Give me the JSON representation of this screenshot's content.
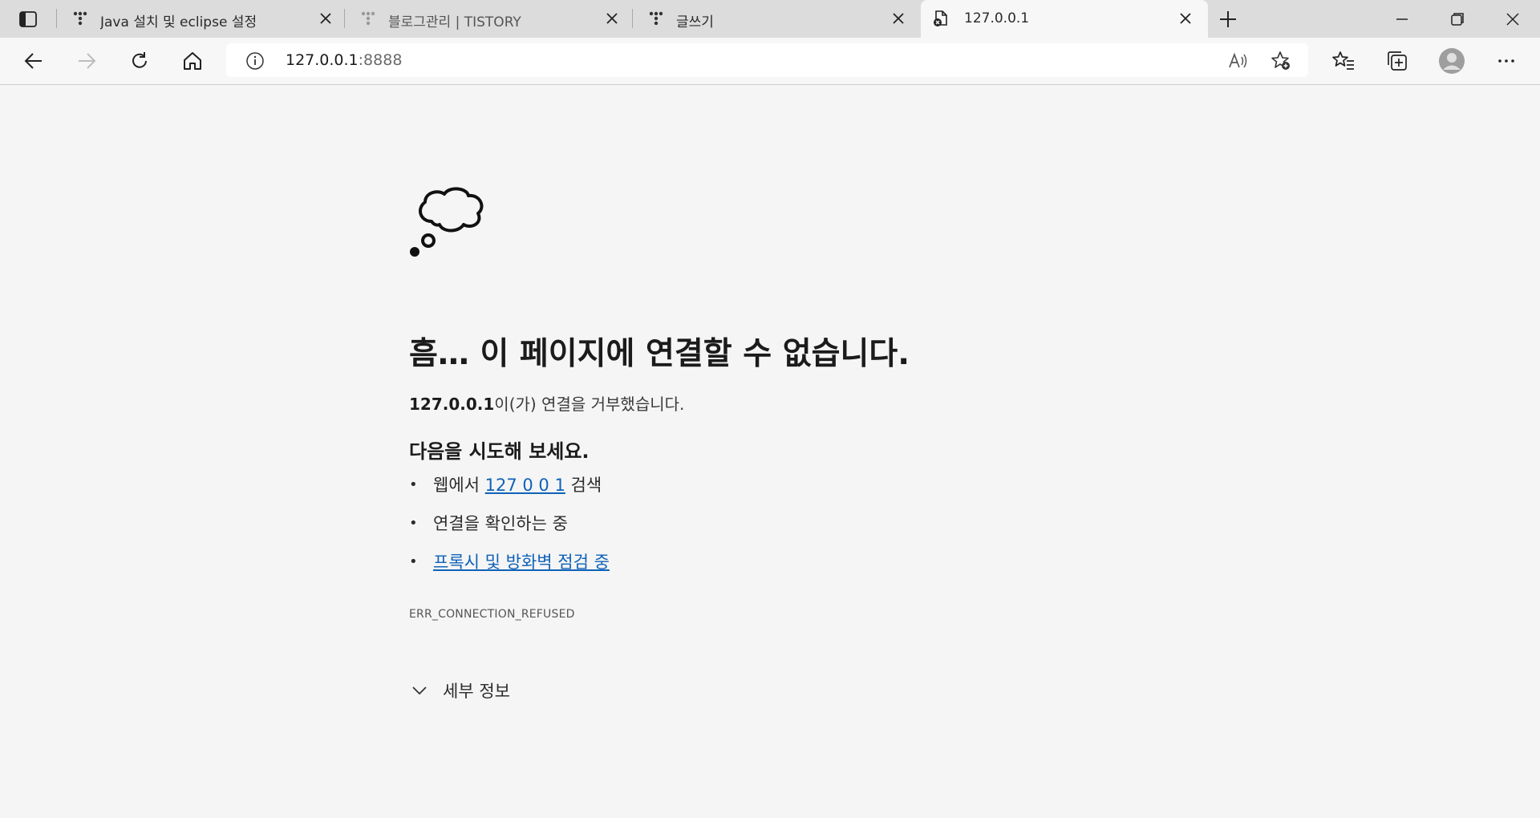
{
  "tabs": [
    {
      "title": "Java 설치 및 eclipse 설정",
      "icon": "tistory-icon"
    },
    {
      "title": "블로그관리 | TISTORY",
      "icon": "tistory-icon"
    },
    {
      "title": "글쓰기",
      "icon": "tistory-icon"
    },
    {
      "title": "127.0.0.1",
      "icon": "error-page-icon",
      "active": true
    }
  ],
  "address_bar": {
    "host": "127.0.0.1",
    "port": ":8888"
  },
  "error_page": {
    "heading": "흠… 이 페이지에 연결할 수 없습니다.",
    "host_bold": "127.0.0.1",
    "description_suffix": "이(가) 연결을 거부했습니다.",
    "try_heading": "다음을 시도해 보세요.",
    "suggestions": {
      "search_prefix": "웹에서 ",
      "search_link": "127 0 0 1",
      "search_suffix": " 검색",
      "check_connection": "연결을 확인하는 중",
      "proxy_firewall": "프록시 및 방화벽 점검 중"
    },
    "error_code": "ERR_CONNECTION_REFUSED",
    "details_label": "세부 정보"
  },
  "colors": {
    "link": "#0f62b8",
    "tabbar": "#dcdcdc",
    "page_bg": "#f5f5f5"
  }
}
